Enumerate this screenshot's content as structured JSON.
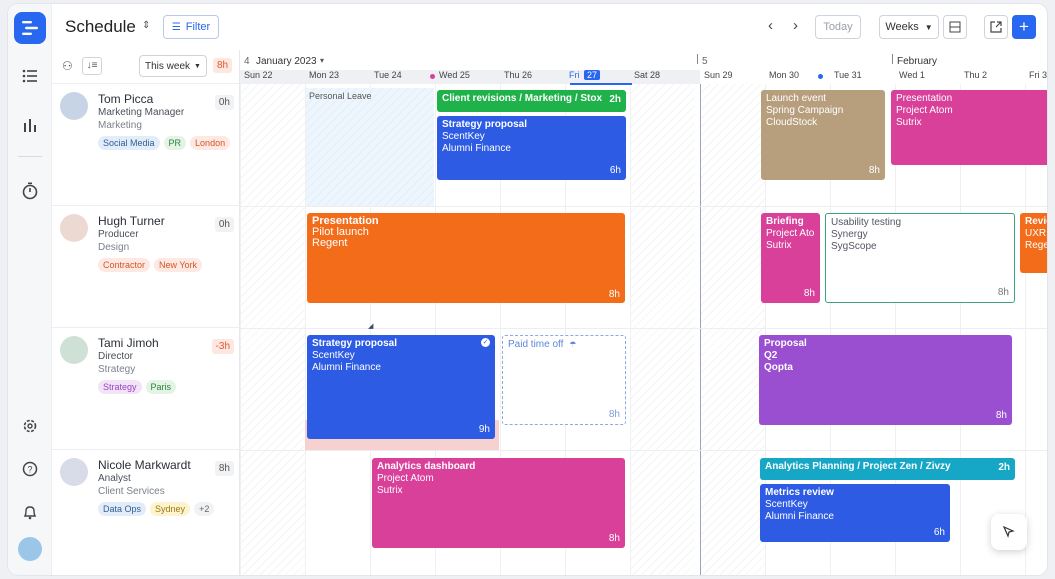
{
  "header": {
    "title": "Schedule",
    "filter_label": "Filter",
    "today_label": "Today",
    "weeks_label": "Weeks",
    "this_week_label": "This week",
    "this_week_hours": "8h"
  },
  "colors": {
    "blue": "#2d5be3",
    "green": "#1fb14a",
    "orange": "#f36c1a",
    "pink": "#d8409a",
    "tan": "#b79e7d",
    "purple": "#9a4ed0",
    "teal": "#16a7c6",
    "accent": "#2867f0"
  },
  "calendar": {
    "month1": "January 2023",
    "month1_num": "4",
    "month2": "February",
    "s_marker": "5",
    "days": [
      "Sun 22",
      "Mon 23",
      "Tue 24",
      "Wed 25",
      "Thu 26",
      "Fri",
      "Sat 28",
      "Sun 29",
      "Mon 30",
      "Tue 31",
      "Wed 1",
      "Thu 2",
      "Fri 3"
    ],
    "today_num": "27"
  },
  "people": [
    {
      "name": "Tom Picca",
      "role": "Marketing Manager",
      "dept": "Marketing",
      "hours": "0h",
      "tags": [
        "Social Media",
        "PR",
        "London"
      ]
    },
    {
      "name": "Hugh Turner",
      "role": "Producer",
      "dept": "Design",
      "hours": "0h",
      "tags": [
        "Contractor",
        "New York"
      ]
    },
    {
      "name": "Tami Jimoh",
      "role": "Director",
      "dept": "Strategy",
      "hours": "-3h",
      "tags": [
        "Strategy",
        "Paris"
      ]
    },
    {
      "name": "Nicole Markwardt",
      "role": "Analyst",
      "dept": "Client Services",
      "hours": "8h",
      "tags": [
        "Data Ops",
        "Sydney",
        "+2"
      ]
    }
  ],
  "events": {
    "personal_leave": "Personal Leave",
    "e1": {
      "title": "Client revisions / Marketing / Stox",
      "hours": "2h"
    },
    "e2": {
      "title": "Strategy proposal",
      "l1": "ScentKey",
      "l2": "Alumni Finance",
      "hours": "6h"
    },
    "e3": {
      "title": "Launch event",
      "l1": "Spring Campaign",
      "l2": "CloudStock",
      "hours": "8h"
    },
    "e4": {
      "title": "Presentation",
      "l1": "Project Atom",
      "l2": "Sutrix"
    },
    "e5": {
      "title": "Presentation",
      "l1": "Pilot launch",
      "l2": "Regent",
      "hours": "8h"
    },
    "e6": {
      "title": "Briefing",
      "l1": "Project Ato",
      "l2": "Sutrix",
      "hours": "8h"
    },
    "e7": {
      "title": "Usability testing",
      "l1": "Synergy",
      "l2": "SygScope",
      "hours": "8h"
    },
    "e8": {
      "title": "Revie",
      "l1": "UXR",
      "l2": "Rege"
    },
    "e9": {
      "title": "Strategy proposal",
      "l1": "ScentKey",
      "l2": "Alumni Finance",
      "hours": "9h"
    },
    "e10": {
      "title": "Paid time off",
      "hours": "8h"
    },
    "e11": {
      "title": "Proposal",
      "l1": "Q2",
      "l2": "Qopta",
      "hours": "8h"
    },
    "e12": {
      "title": "Analytics dashboard",
      "l1": "Project Atom",
      "l2": "Sutrix",
      "hours": "8h"
    },
    "e13": {
      "title": "Analytics Planning / Project Zen / Zivzy",
      "hours": "2h"
    },
    "e14": {
      "title": "Metrics review",
      "l1": "ScentKey",
      "l2": "Alumni Finance",
      "hours": "6h"
    }
  }
}
